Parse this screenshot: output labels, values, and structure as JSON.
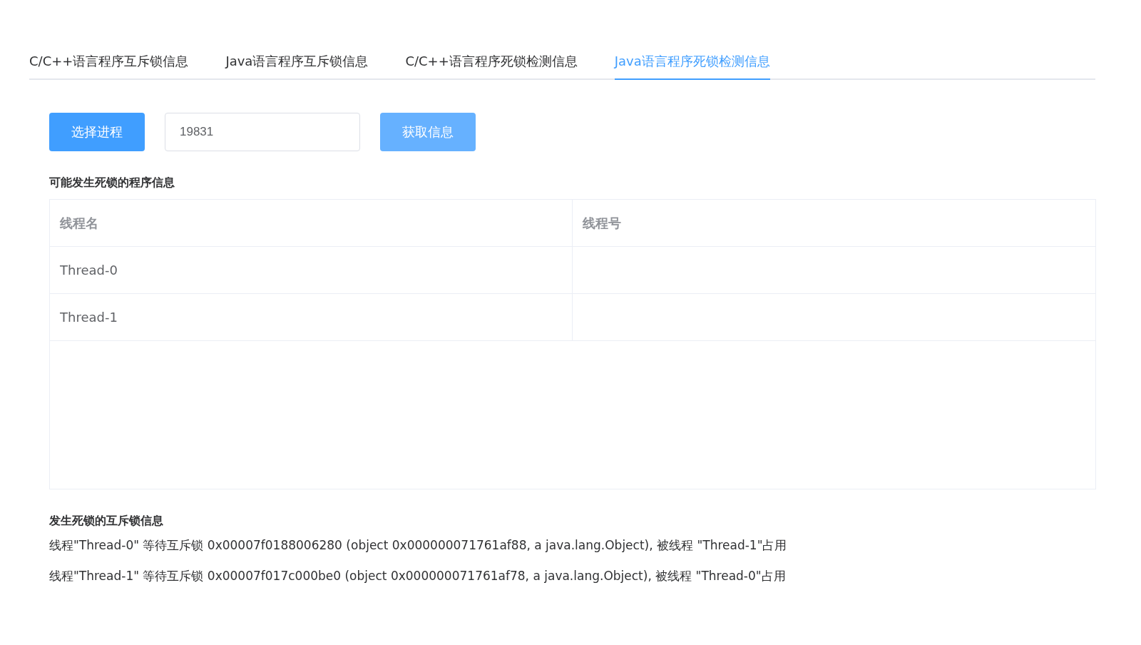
{
  "tabs": [
    {
      "label": "C/C++语言程序互斥锁信息",
      "selected": false
    },
    {
      "label": "Java语言程序互斥锁信息",
      "selected": false
    },
    {
      "label": "C/C++语言程序死锁检测信息",
      "selected": false
    },
    {
      "label": "Java语言程序死锁检测信息",
      "selected": true
    }
  ],
  "toolbar": {
    "select_button": "选择进程",
    "pid_field": {
      "value": "19831"
    },
    "fetch_button": {
      "label": "获取信息",
      "disabled": true
    }
  },
  "threads_section": {
    "title": "可能发生死锁的程序信息",
    "table": {
      "columns": [
        "线程名",
        "线程号"
      ],
      "rows": [
        [
          "Thread-0"
        ],
        [
          "Thread-1"
        ]
      ]
    }
  },
  "mutex_section": {
    "title": "发生死锁的互斥锁信息",
    "lines": [
      "线程\"Thread-0\" 等待互斥锁 0x00007f0188006280 (object 0x000000071761af88, a java.lang.Object), 被线程 \"Thread-1\"占用",
      "线程\"Thread-1\" 等待互斥锁 0x00007f017c000be0 (object 0x000000071761af78, a java.lang.Object), 被线程 \"Thread-0\"占用"
    ]
  }
}
